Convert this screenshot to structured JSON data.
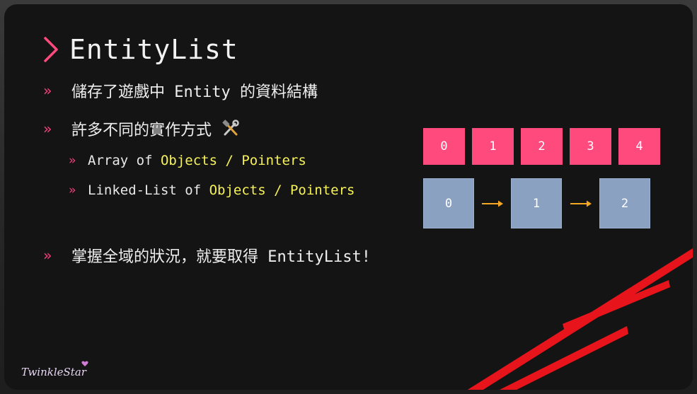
{
  "slide": {
    "title": "EntityList",
    "bullets": [
      {
        "mark": "»",
        "text": "儲存了遊戲中 Entity 的資料結構"
      },
      {
        "mark": "»",
        "text": "許多不同的實作方式"
      },
      {
        "mark": "»",
        "text": "掌握全域的狀況，就要取得 EntityList!"
      }
    ],
    "sub_bullets": [
      {
        "mark": "»",
        "prefix": "Array of ",
        "highlight": "Objects / Pointers"
      },
      {
        "mark": "»",
        "prefix": "Linked-List of ",
        "highlight": "Objects / Pointers"
      }
    ],
    "tools_icon": "hammer-and-wrench-icon",
    "array_cells": [
      "0",
      "1",
      "2",
      "3",
      "4"
    ],
    "list_nodes": [
      "0",
      "1",
      "2"
    ],
    "logo_text": "TwinkleStar"
  },
  "colors": {
    "accent_pink": "#ff4a7e",
    "bullet_pink": "#ff3d7f",
    "highlight_yellow": "#f6f25a",
    "node_blue": "#8aa1c2",
    "arrow_orange": "#f5a623",
    "stripe_red": "#e8141c"
  }
}
